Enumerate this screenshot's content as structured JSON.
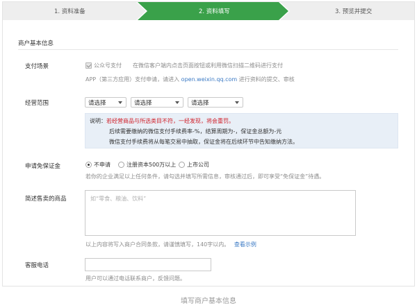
{
  "steps": [
    {
      "label": "1. 资料准备",
      "active": false
    },
    {
      "label": "2. 资料填写",
      "active": true
    },
    {
      "label": "3. 预览并提交",
      "active": false
    }
  ],
  "colors": {
    "step_active": "#3aa14a",
    "step_inactive": "#eeeeee",
    "link": "#3a79c4",
    "warning": "#d0202a",
    "notice_bg": "#e8eff7"
  },
  "section_title": "商户基本信息",
  "payment_scene": {
    "label": "支付场景",
    "checkbox_label": "公众号支付",
    "checked": true,
    "desc_line1": "在微信客户端内点击页面按钮或利用微信扫描二维码进行支付",
    "desc_line2_prefix": "APP（第三方应用）支付申请，请进入",
    "desc_link": "open.weixin.qq.com",
    "desc_line2_suffix": "进行资料的提交、审核"
  },
  "business_scope": {
    "label": "经营范围",
    "selects": [
      "请选择",
      "请选择",
      "请选择"
    ]
  },
  "notice": {
    "prefix": "说明：",
    "warning": "若经营商品与所选类目不符，一经发现，将会重罚。",
    "line2": "后续需要缴纳的微信支付手续费率-%，结算周期为-，保证金总额为-元",
    "line3": "微信支付手续费将从每笔交易中抽取，保证金将在后续环节中告知缴纳方法。"
  },
  "deposit_exemption": {
    "label": "申请免保证金",
    "options": [
      "不申请",
      "注册资本500万以上",
      "上市公司"
    ],
    "selected_index": 0,
    "hint": "若你的企业满足以上任何条件，请勾选并填写所需信息，审核通过后，即可享受“免保证金”待遇。"
  },
  "goods": {
    "label": "简述售卖的商品",
    "placeholder": "如“零食、粮油、饮料”",
    "hint": "以上内容将写入商户合同条款，请谨慎填写，140字以内。",
    "hint_link": "查看示例"
  },
  "service_phone": {
    "label": "客服电话",
    "value": "",
    "hint": "用户可以通过电话联系商户，反馈问题。"
  },
  "caption": "填写商户基本信息"
}
